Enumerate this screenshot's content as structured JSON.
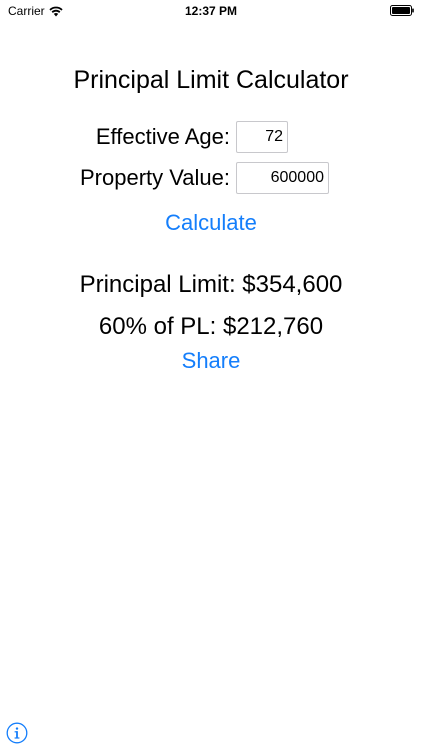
{
  "status_bar": {
    "carrier": "Carrier",
    "time": "12:37 PM"
  },
  "title": "Principal Limit Calculator",
  "form": {
    "age_label": "Effective Age:",
    "age_value": "72",
    "property_label": "Property Value:",
    "property_value": "600000"
  },
  "calculate_label": "Calculate",
  "results": {
    "principal_limit": "Principal Limit: $354,600",
    "sixty_percent": "60% of PL: $212,760"
  },
  "share_label": "Share",
  "icons": {
    "wifi": "wifi-icon",
    "battery": "battery-icon",
    "info": "info-icon"
  },
  "colors": {
    "accent": "#147efb",
    "text": "#000000",
    "background": "#ffffff"
  }
}
